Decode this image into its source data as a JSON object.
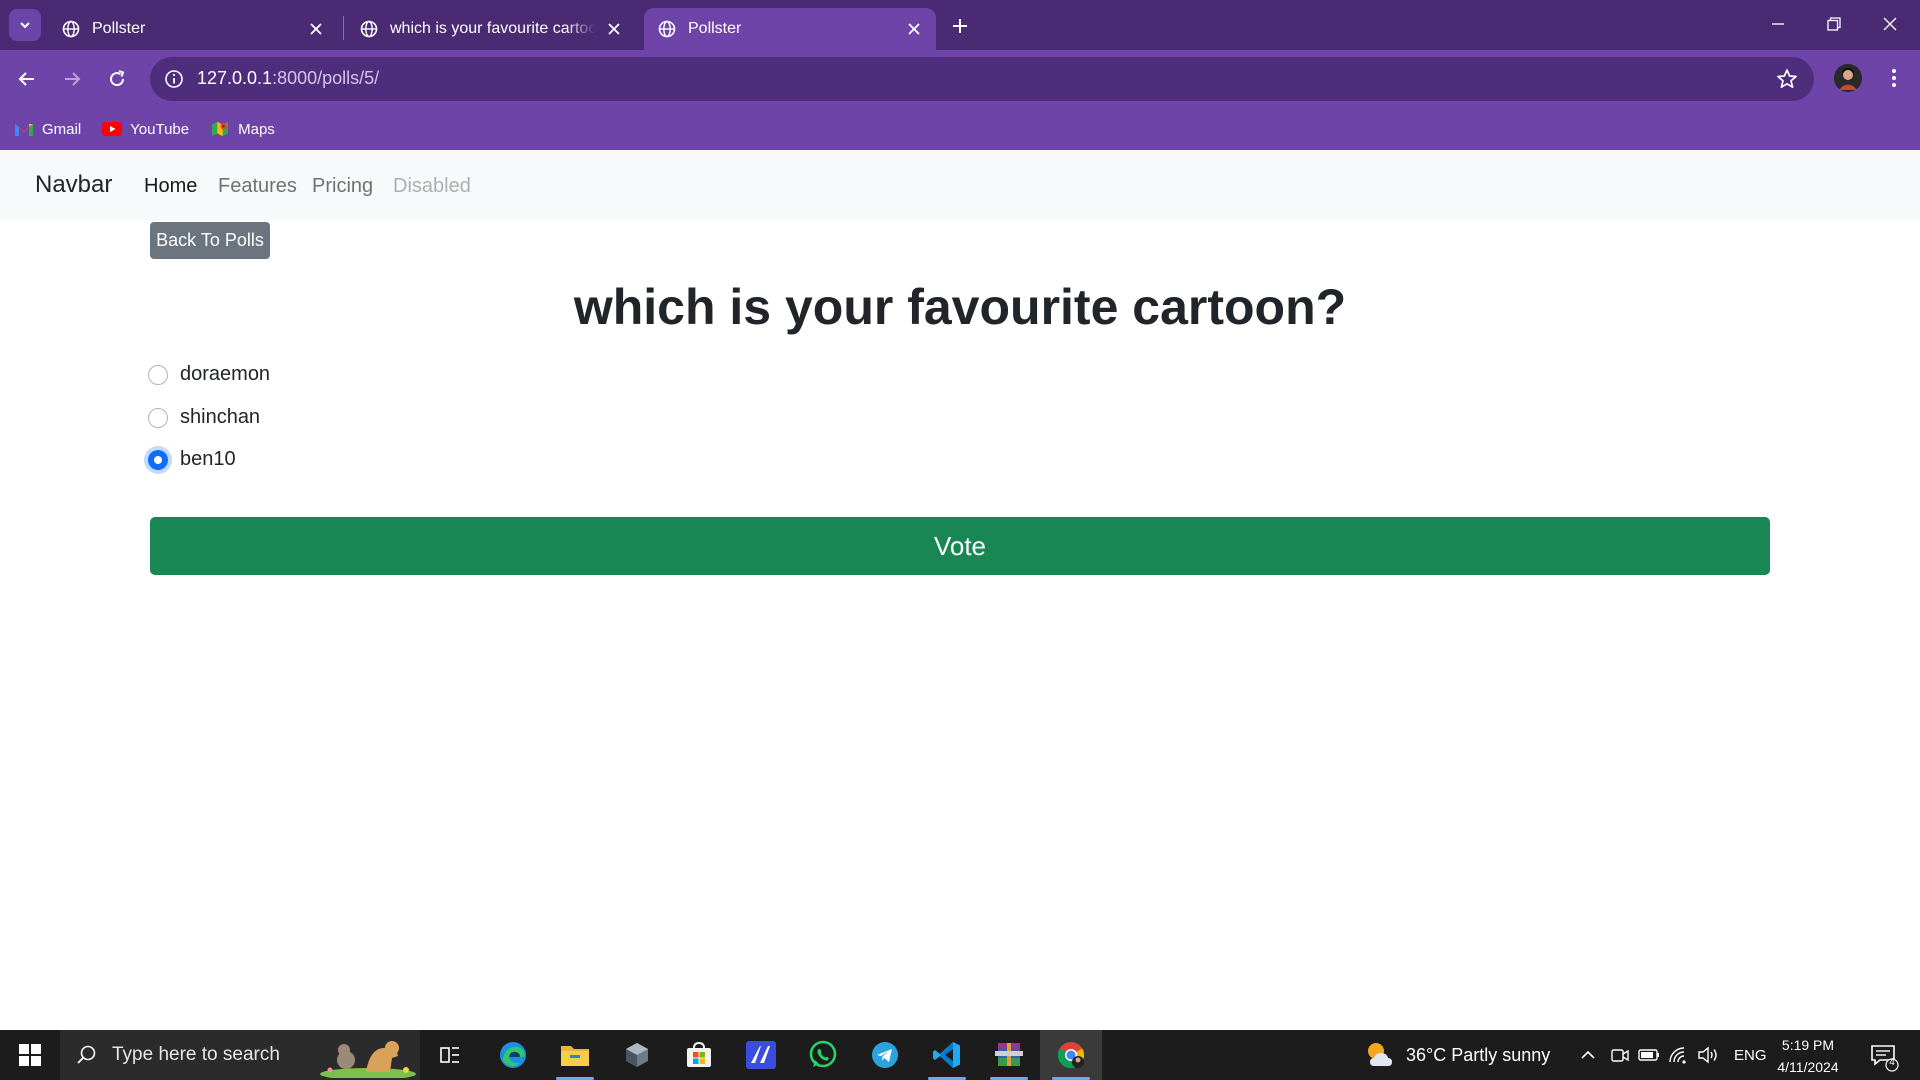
{
  "browser": {
    "tabs": [
      {
        "title": "Pollster",
        "active": false
      },
      {
        "title": "which is your favourite cartoon?",
        "active": false
      },
      {
        "title": "Pollster",
        "active": true
      }
    ],
    "url_host": "127.0.0.1",
    "url_path": ":8000/polls/5/",
    "bookmarks": [
      {
        "label": "Gmail",
        "icon": "gmail-icon"
      },
      {
        "label": "YouTube",
        "icon": "youtube-icon"
      },
      {
        "label": "Maps",
        "icon": "maps-icon"
      }
    ]
  },
  "navbar": {
    "brand": "Navbar",
    "links": [
      {
        "label": "Home",
        "state": "active"
      },
      {
        "label": "Features",
        "state": "normal"
      },
      {
        "label": "Pricing",
        "state": "normal"
      },
      {
        "label": "Disabled",
        "state": "disabled"
      }
    ]
  },
  "poll": {
    "back_label": "Back To Polls",
    "question": "which is your favourite cartoon?",
    "options": [
      {
        "label": "doraemon",
        "checked": false
      },
      {
        "label": "shinchan",
        "checked": false
      },
      {
        "label": "ben10",
        "checked": true
      }
    ],
    "vote_label": "Vote"
  },
  "taskbar": {
    "search_placeholder": "Type here to search",
    "weather": "36°C  Partly sunny",
    "language": "ENG",
    "time": "5:19 PM",
    "date": "4/11/2024",
    "notification_count": "4"
  },
  "colors": {
    "chrome_dark": "#4a2a72",
    "chrome_light": "#6e44a8",
    "vote_green": "#198754",
    "back_gray": "#6c757d",
    "radio_blue": "#0d6efd"
  }
}
